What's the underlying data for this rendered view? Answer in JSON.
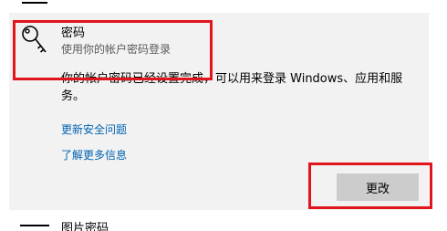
{
  "password_section": {
    "title": "密码",
    "subtitle": "使用你的帐户密码登录",
    "description": "你的帐户密码已经设置完成，可以用来登录 Windows、应用和服务。",
    "links": {
      "update_security_questions": "更新安全问题",
      "learn_more": "了解更多信息"
    },
    "change_button": "更改"
  },
  "next_section": {
    "title": "图片密码"
  },
  "colors": {
    "panel_bg": "#f2f2f2",
    "link": "#0063b1",
    "button_bg": "#cccccc",
    "highlight": "#e2141c"
  }
}
